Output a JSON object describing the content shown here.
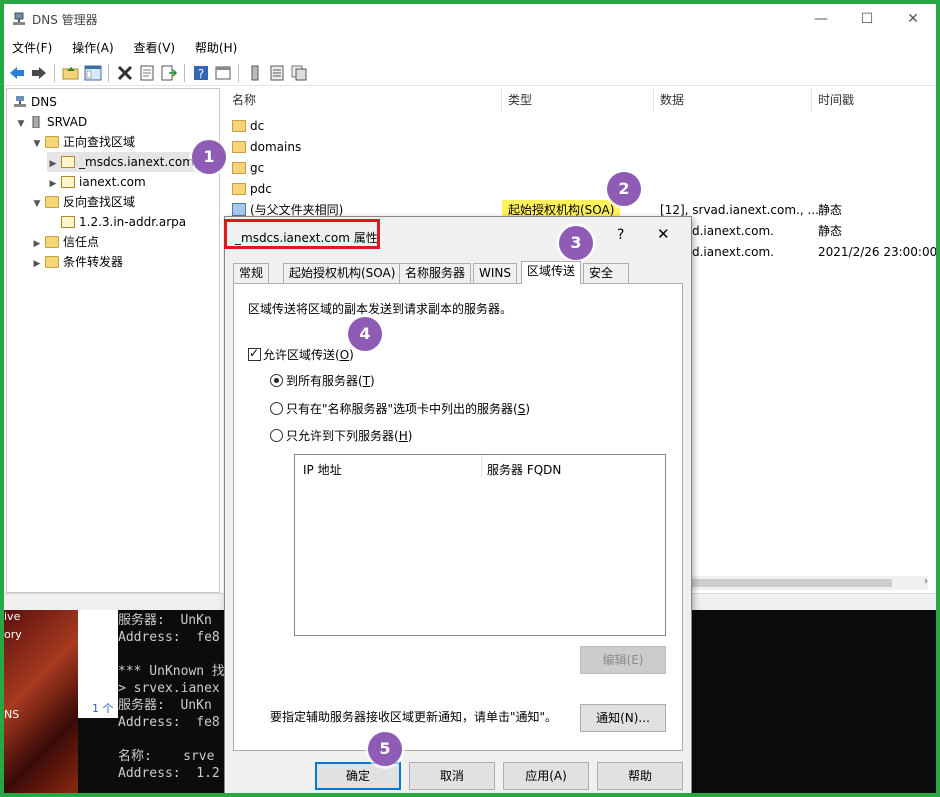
{
  "window": {
    "title": "DNS 管理器",
    "min": "—",
    "max": "☐",
    "close": "✕"
  },
  "menu": [
    "文件(F)",
    "操作(A)",
    "查看(V)",
    "帮助(H)"
  ],
  "tree": {
    "root": "DNS",
    "server": "SRVAD",
    "forward": "正向查找区域",
    "msdcs": "_msdcs.ianext.com",
    "ianext": "ianext.com",
    "reverse": "反向查找区域",
    "arpa": "1.2.3.in-addr.arpa",
    "trust": "信任点",
    "cond": "条件转发器"
  },
  "list": {
    "headers": [
      "名称",
      "类型",
      "数据",
      "时间戳"
    ],
    "rows": [
      {
        "name": "dc",
        "type": "",
        "data": "",
        "ts": ""
      },
      {
        "name": "domains",
        "type": "",
        "data": "",
        "ts": ""
      },
      {
        "name": "gc",
        "type": "",
        "data": "",
        "ts": ""
      },
      {
        "name": "pdc",
        "type": "",
        "data": "",
        "ts": ""
      },
      {
        "name": "(与父文件夹相同)",
        "type": "起始授权机构(SOA)",
        "data": "[12], srvad.ianext.com., ...",
        "ts": "静态"
      },
      {
        "name": "",
        "type": "",
        "data": "d.ianext.com.",
        "ts": "静态"
      },
      {
        "name": "",
        "type": "",
        "data": "d.ianext.com.",
        "ts": "2021/2/26 23:00:00"
      }
    ]
  },
  "console": {
    "lines": [
      "服务器:  UnKn",
      "Address:  fe8",
      "",
      "*** UnKnown 找",
      "> srvex.ianex",
      "服务器:  UnKn",
      "Address:  fe8",
      "",
      "名称:    srve",
      "Address:  1.2"
    ],
    "left_labels": [
      "ive",
      "ory",
      "NS"
    ],
    "count": "1 个"
  },
  "dialog": {
    "title": "_msdcs.ianext.com 属性",
    "help": "?",
    "close": "✕",
    "tabs": [
      "常规",
      "起始授权机构(SOA)",
      "名称服务器",
      "WINS",
      "区域传送",
      "安全"
    ],
    "desc": "区域传送将区域的副本发送到请求副本的服务器。",
    "allow_label": "允许区域传送(O)",
    "allow_pre": "允许区域传送(",
    "allow_key": "O",
    "allow_post": ")",
    "radio1_pre": "到所有服务器(",
    "radio1_key": "T",
    "radio2_pre": "只有在\"名称服务器\"选项卡中列出的服务器(",
    "radio2_key": "S",
    "radio3_pre": "只允许到下列服务器(",
    "radio3_key": "H",
    "close_paren": ")",
    "ip_col": "IP 地址",
    "fqdn_col": "服务器 FQDN",
    "edit_btn": "编辑(E)",
    "notify_text": "要指定辅助服务器接收区域更新通知，请单击\"通知\"。",
    "notify_btn": "通知(N)...",
    "ok": "确定",
    "cancel": "取消",
    "apply": "应用(A)",
    "helpbtn": "帮助"
  },
  "badges": [
    "1",
    "2",
    "3",
    "4",
    "5"
  ],
  "colors": {
    "accent": "#0078d7",
    "badge": "#8e5bb5",
    "annotation": "#e3161d",
    "highlight": "#fff25a",
    "border": "#28a745"
  }
}
